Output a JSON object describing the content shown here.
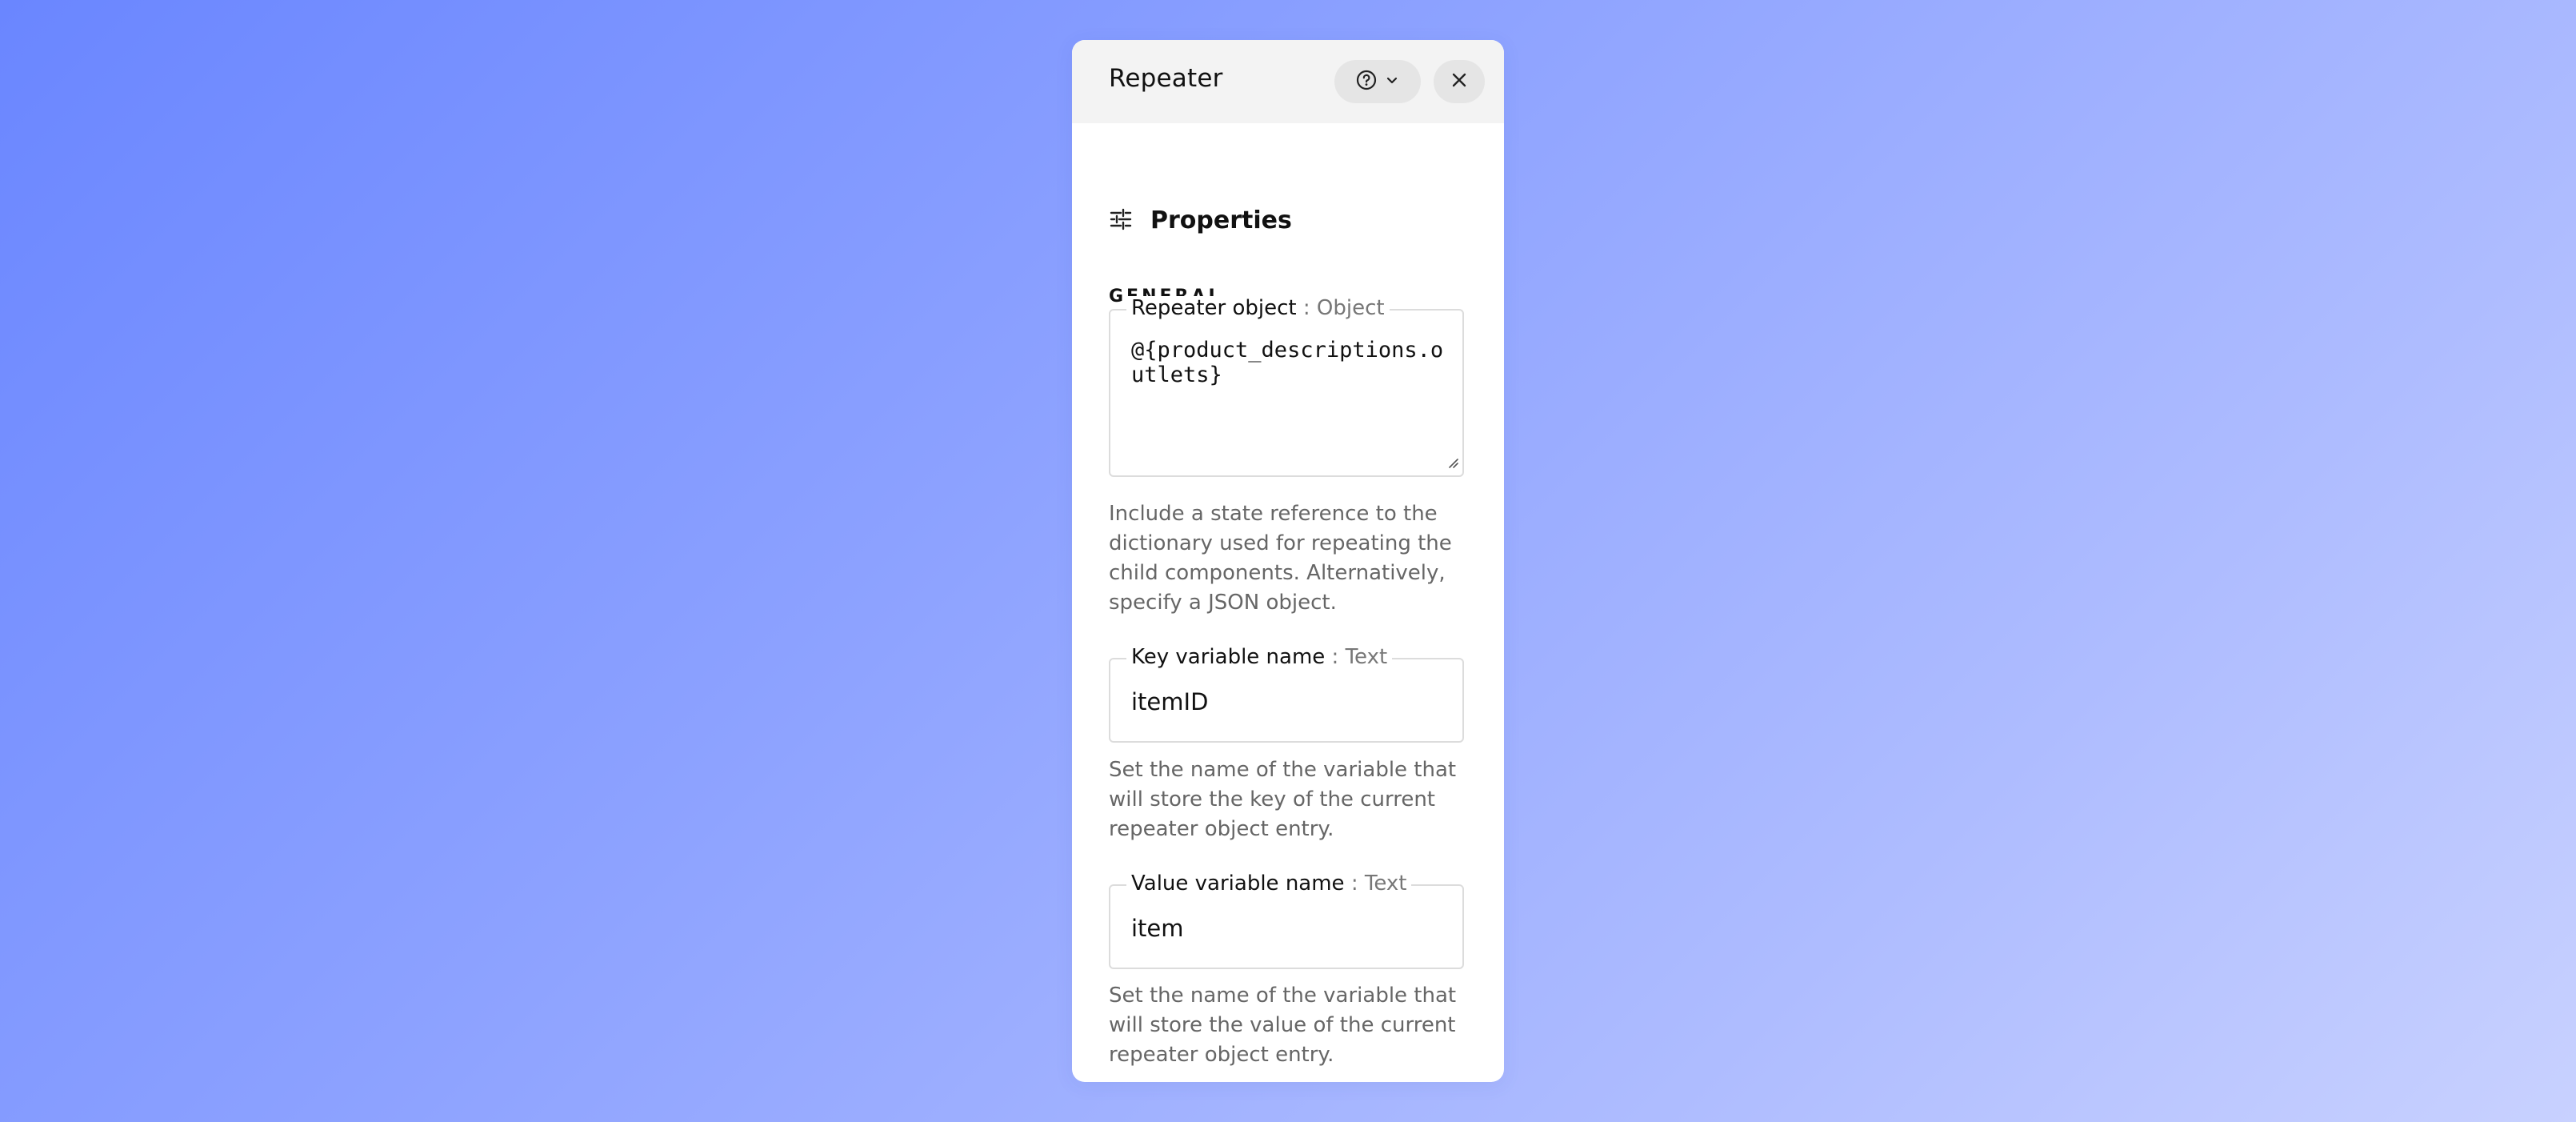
{
  "header": {
    "title": "Repeater",
    "help_icon": "help-circle-icon",
    "chevron_icon": "chevron-down-icon",
    "close_icon": "close-icon"
  },
  "section": {
    "icon": "sliders-icon",
    "title": "Properties",
    "group_label": "GENERAL"
  },
  "fields": [
    {
      "label": "Repeater object",
      "type": " : Object",
      "value": "@{product_descriptions.outlets}",
      "help": "Include a state reference to the dictionary used for repeating the child components. Alternatively, specify a JSON object."
    },
    {
      "label": "Key variable name",
      "type": " : Text",
      "value": "itemID",
      "help": "Set the name of the variable that will store the key of the current repeater object entry."
    },
    {
      "label": "Value variable name",
      "type": " : Text",
      "value": "item",
      "help": "Set the name of the variable that will store the value of the current repeater object entry."
    }
  ]
}
